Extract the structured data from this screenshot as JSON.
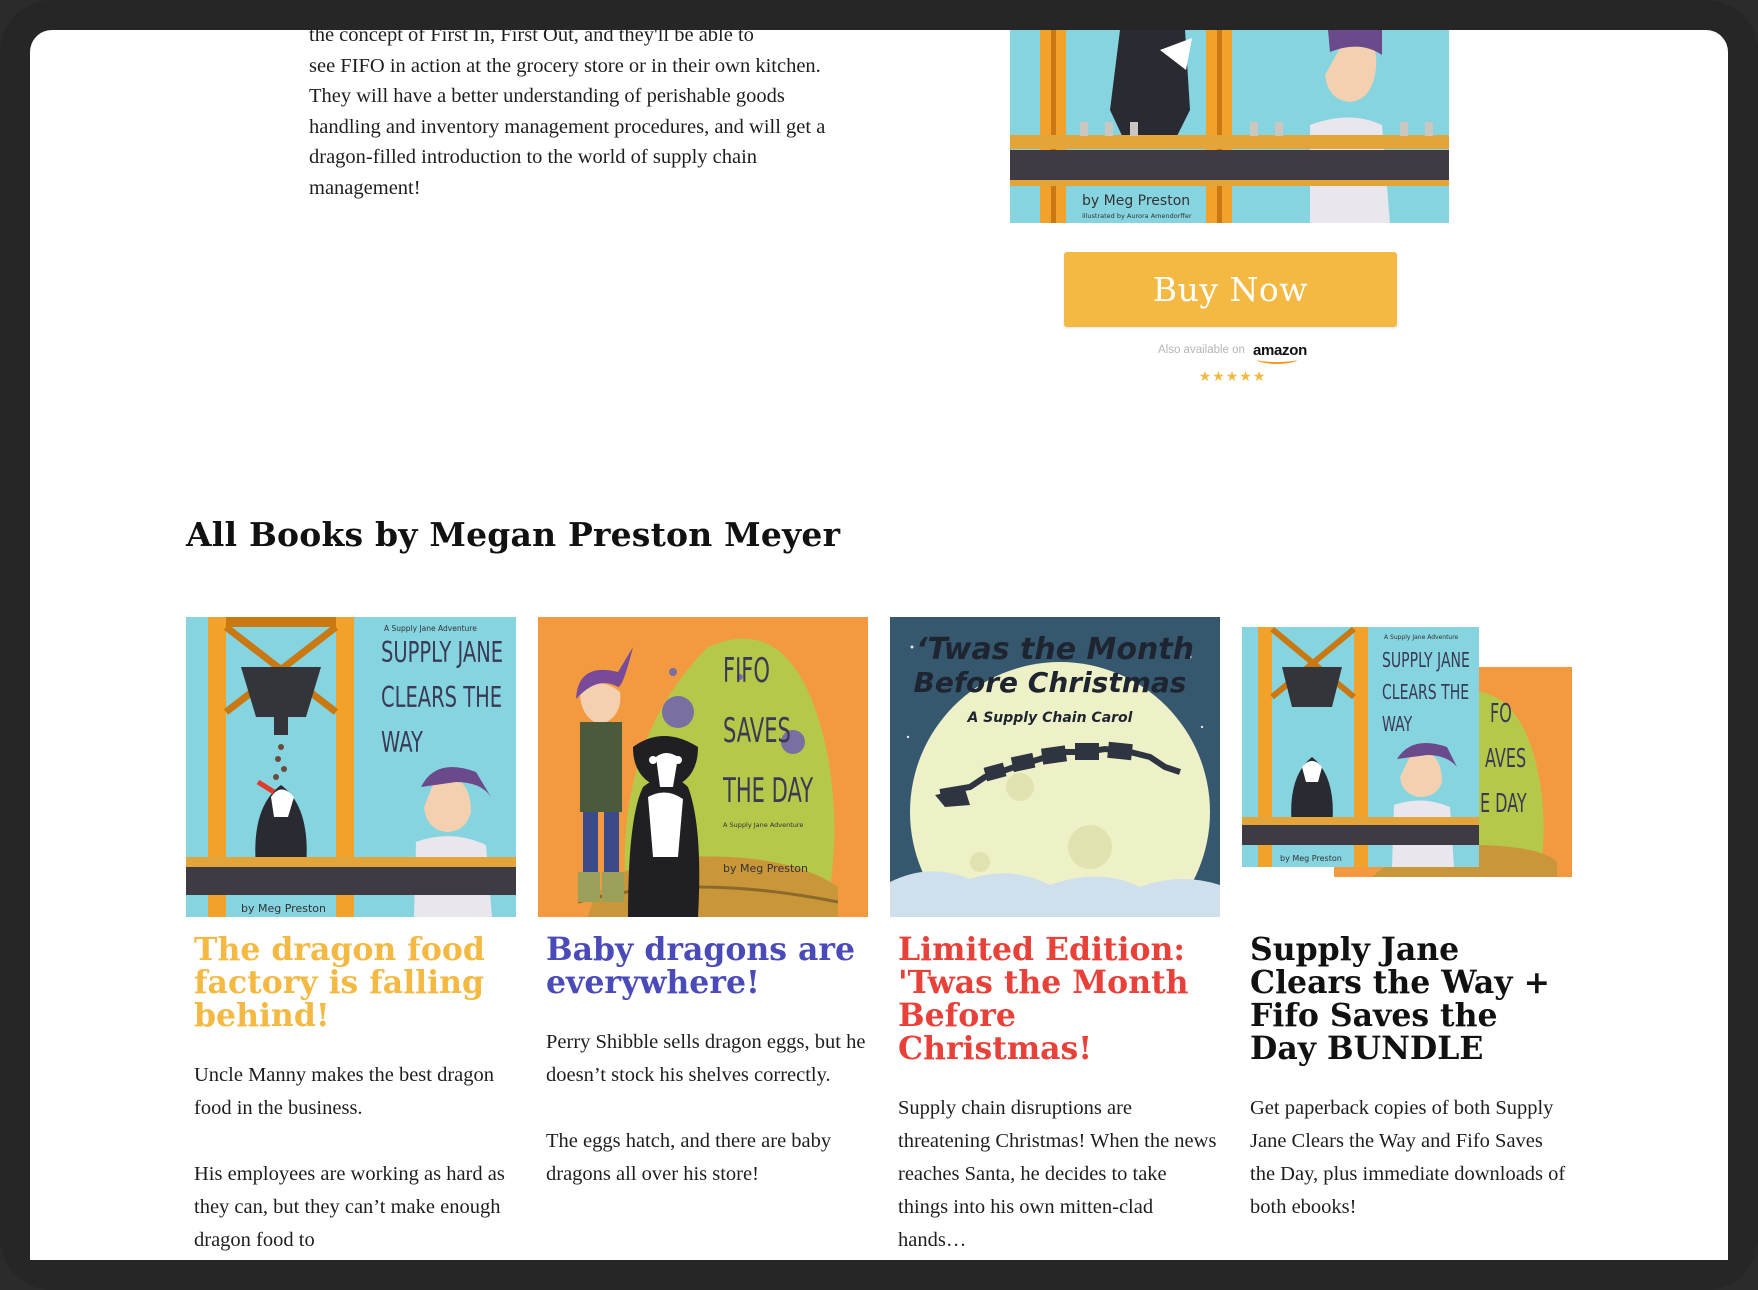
{
  "intro": {
    "cut_line": "the concept of First In, First Out, and they'll be able to",
    "text": "see FIFO in action at the grocery store or in their own kitchen. They will have a better understanding of perishable goods handling and inventory management procedures, and will get a dragon-filled introduction to the world of supply chain management!"
  },
  "hero": {
    "byline": "by Meg Preston",
    "illustrator": "illustrated by Aurora Amendorffer",
    "buy_label": "Buy Now",
    "also_label": "Also available on",
    "amazon": "amazon",
    "stars": "★★★★★",
    "rating": 5
  },
  "section": {
    "title": "All Books by Megan Preston Meyer"
  },
  "books": [
    {
      "title": "The dragon food factory is falling behind!",
      "title_color": "#f4b942",
      "cover": {
        "series": "A Supply Jane Adventure",
        "name_lines": [
          "SUPPLY JANE",
          "CLEARS THE",
          "WAY"
        ],
        "byline": "by Meg Preston"
      },
      "desc": [
        "Uncle Manny makes the best dragon food in the business.",
        "His employees are working as hard as they can, but they can’t make enough dragon food to"
      ]
    },
    {
      "title": "Baby dragons are everywhere!",
      "title_color": "#4a4ab8",
      "cover": {
        "series": "A Supply Jane Adventure",
        "name_lines": [
          "FIFO",
          "SAVES",
          "THE DAY"
        ],
        "byline": "by Meg Preston"
      },
      "desc": [
        "Perry Shibble sells dragon eggs, but he doesn’t stock his shelves correctly.",
        "The eggs hatch, and there are baby dragons all over his store!"
      ]
    },
    {
      "title": "Limited Edition: 'Twas the Month Before Christmas!",
      "title_color": "#e8413a",
      "cover": {
        "title_lines": [
          "‘Twas the Month",
          "Before Christmas"
        ],
        "subtitle": "A Supply Chain Carol"
      },
      "desc": [
        "Supply chain disruptions are threatening Christmas! When the news reaches Santa, he decides to take things into his own mitten-clad hands…"
      ]
    },
    {
      "title": "Supply Jane Clears the Way + Fifo Saves the Day BUNDLE",
      "title_color": "#111111",
      "cover": {
        "series": "A Supply Jane Adventure",
        "name_lines": [
          "SUPPLY JANE",
          "CLEARS THE",
          "WAY"
        ],
        "back_lines": [
          "FO",
          "AVES",
          "E DAY"
        ],
        "byline": "by Meg Preston"
      },
      "desc": [
        "Get paperback copies of both Supply Jane Clears the Way and Fifo Saves the Day, plus immediate downloads of both ebooks!"
      ]
    }
  ]
}
